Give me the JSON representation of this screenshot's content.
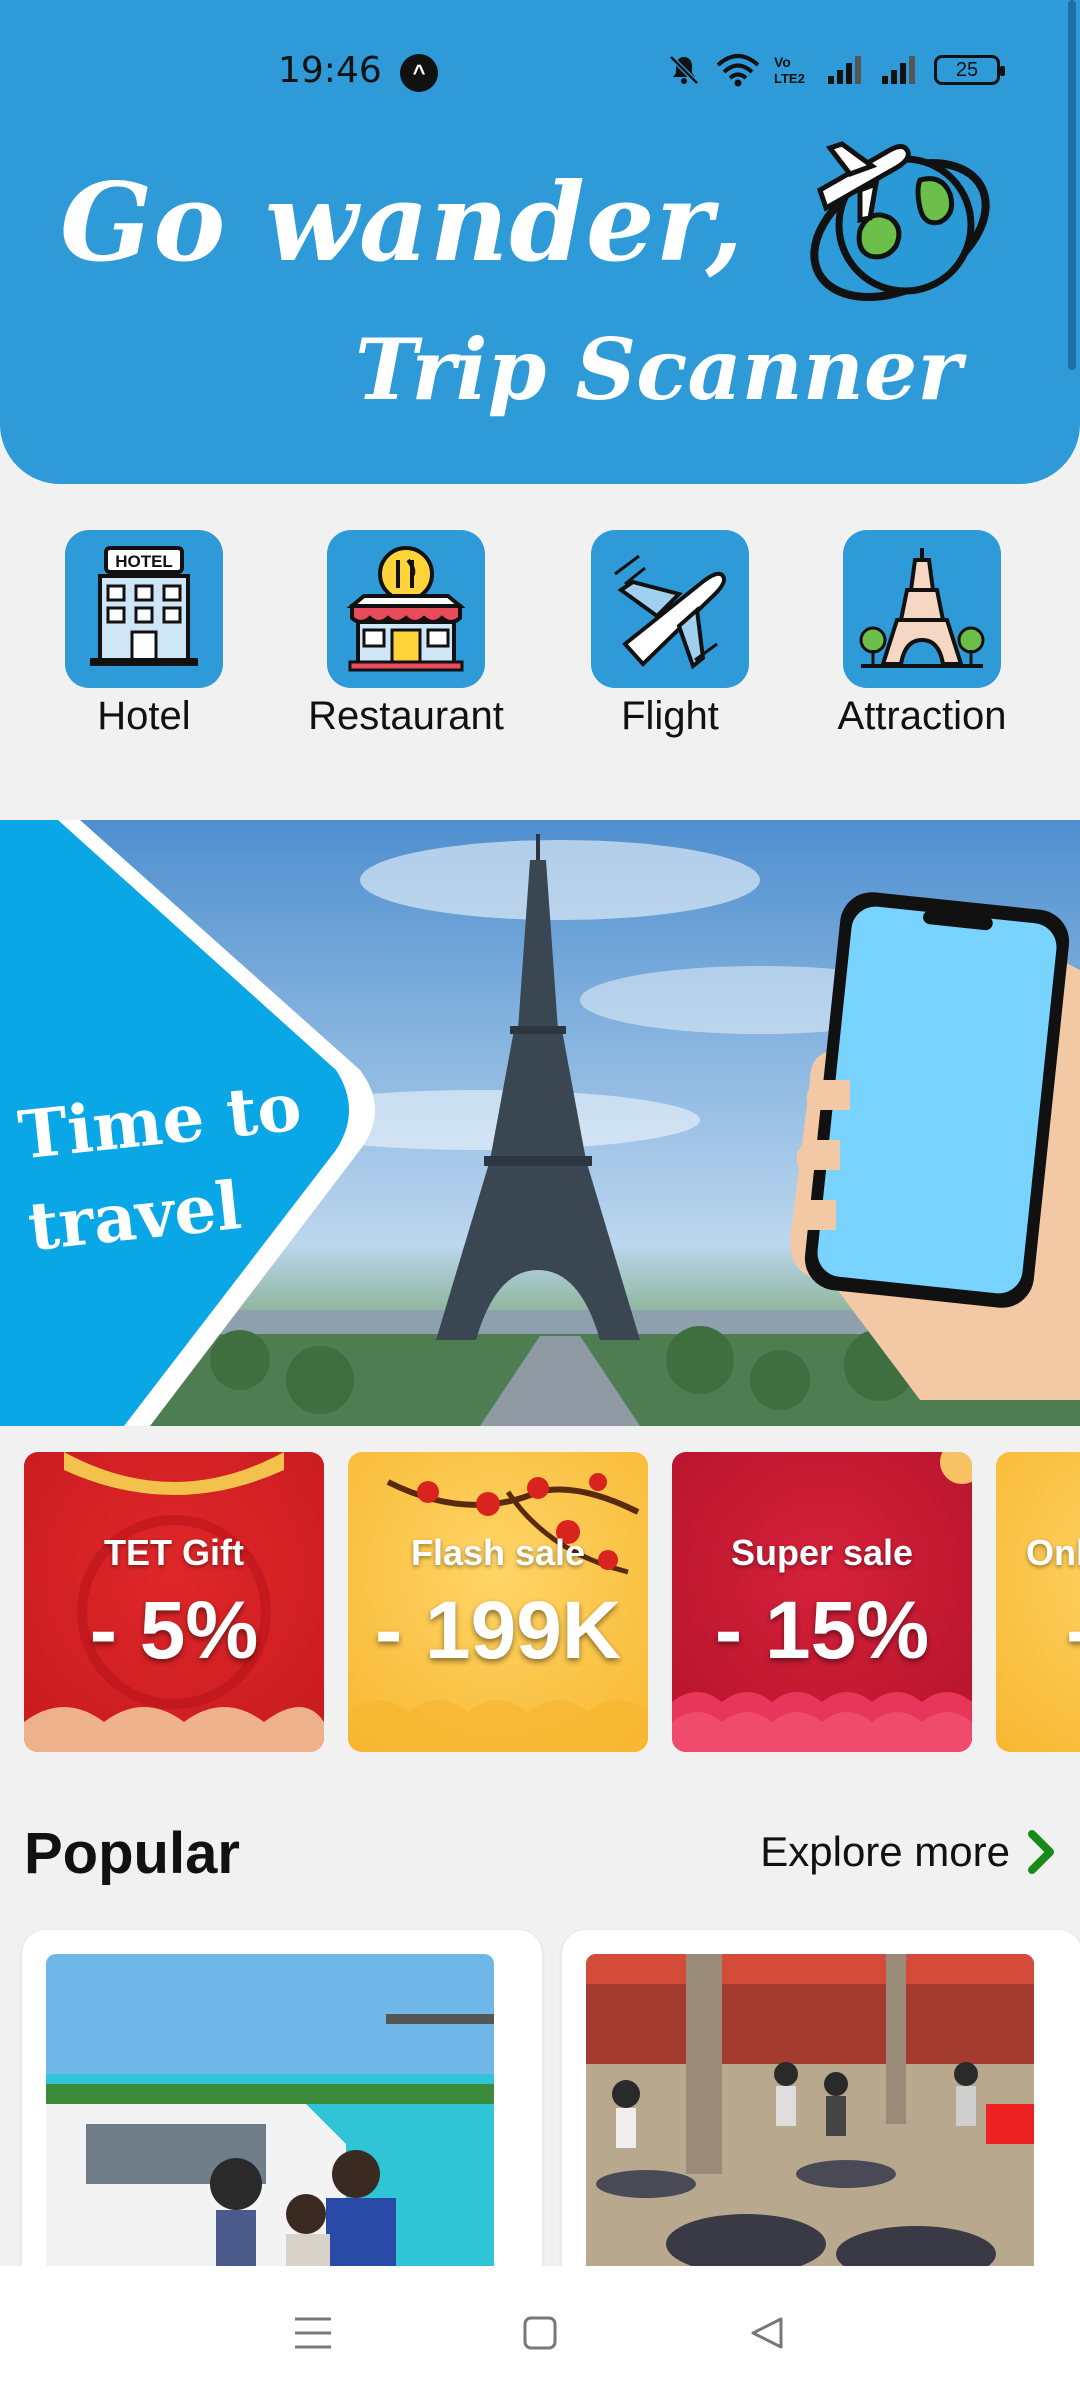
{
  "status_bar": {
    "time": "19:46",
    "battery": "25"
  },
  "header": {
    "line1": "Go wander,",
    "line2": "Trip Scanner"
  },
  "categories": [
    {
      "label": "Hotel",
      "icon": "hotel-icon",
      "badge": "HOTEL"
    },
    {
      "label": "Restaurant",
      "icon": "restaurant-icon"
    },
    {
      "label": "Flight",
      "icon": "airplane-icon"
    },
    {
      "label": "Attraction",
      "icon": "eiffel-tower-icon"
    }
  ],
  "banner": {
    "line1": "Time to",
    "line2": "travel"
  },
  "deals": [
    {
      "title": "TET Gift",
      "value": "- 5%",
      "color": "#d92023"
    },
    {
      "title": "Flash sale",
      "value": "- 199K",
      "color": "#fbc646"
    },
    {
      "title": "Super sale",
      "value": "- 15%",
      "color": "#c51a30"
    },
    {
      "title": "Onl",
      "value": "-",
      "color": "#fbc646"
    }
  ],
  "popular": {
    "title": "Popular",
    "explore_label": "Explore more",
    "accent": "#1a8a1a"
  },
  "colors": {
    "primary": "#2e9ad8",
    "background": "#f1f1f1"
  }
}
